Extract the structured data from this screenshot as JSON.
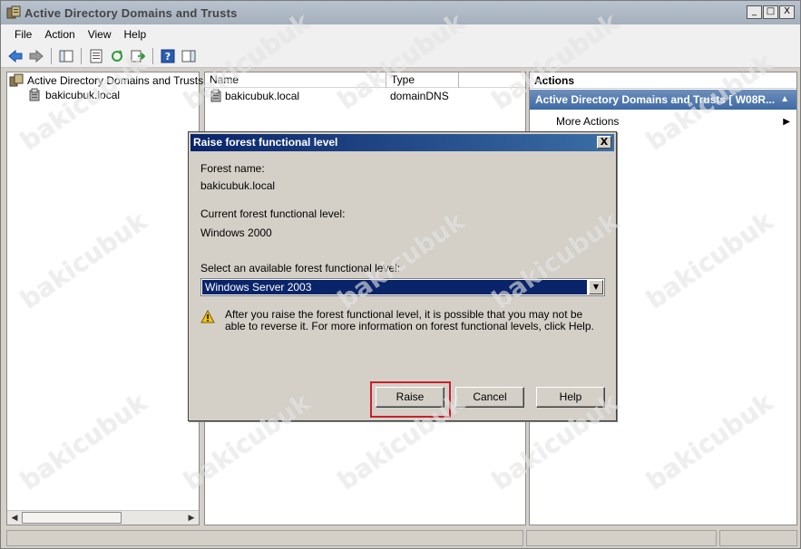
{
  "window": {
    "title": "Active Directory Domains and Trusts",
    "controls": {
      "minimize": "_",
      "maximize": "□",
      "close": "X"
    }
  },
  "menubar": {
    "items": [
      "File",
      "Action",
      "View",
      "Help"
    ]
  },
  "toolbar": {
    "icons": [
      "back-arrow-icon",
      "forward-arrow-icon",
      "show-hide-tree-icon",
      "properties-icon",
      "refresh-icon",
      "export-list-icon",
      "help-icon",
      "show-hide-action-pane-icon"
    ]
  },
  "tree": {
    "root": "Active Directory Domains and Trusts [ W",
    "child": "bakicubuk.local"
  },
  "list": {
    "columns": [
      "Name",
      "Type"
    ],
    "rows": [
      {
        "name": "bakicubuk.local",
        "type": "domainDNS"
      }
    ]
  },
  "actions": {
    "header": "Actions",
    "section": "Active Directory Domains and Trusts [ W08R...",
    "items": [
      "More Actions"
    ]
  },
  "dialog": {
    "title": "Raise forest functional level",
    "close": "X",
    "forest_name_label": "Forest name:",
    "forest_name_value": "bakicubuk.local",
    "current_level_label": "Current forest functional level:",
    "current_level_value": "Windows 2000",
    "select_label": "Select an available forest functional level:",
    "select_value": "Windows Server 2003",
    "warning_text": "After you raise the forest functional level, it is possible that you may not be able to reverse it. For more information on forest functional levels, click Help.",
    "buttons": {
      "raise": "Raise",
      "cancel": "Cancel",
      "help": "Help"
    }
  },
  "watermark": "bakicubuk",
  "colors": {
    "dialog_title_start": "#0a246a",
    "dialog_title_end": "#3b6ea5",
    "selection": "#0a246a",
    "actions_section": "#3e6aa5",
    "highlight_box": "#c8212b"
  }
}
